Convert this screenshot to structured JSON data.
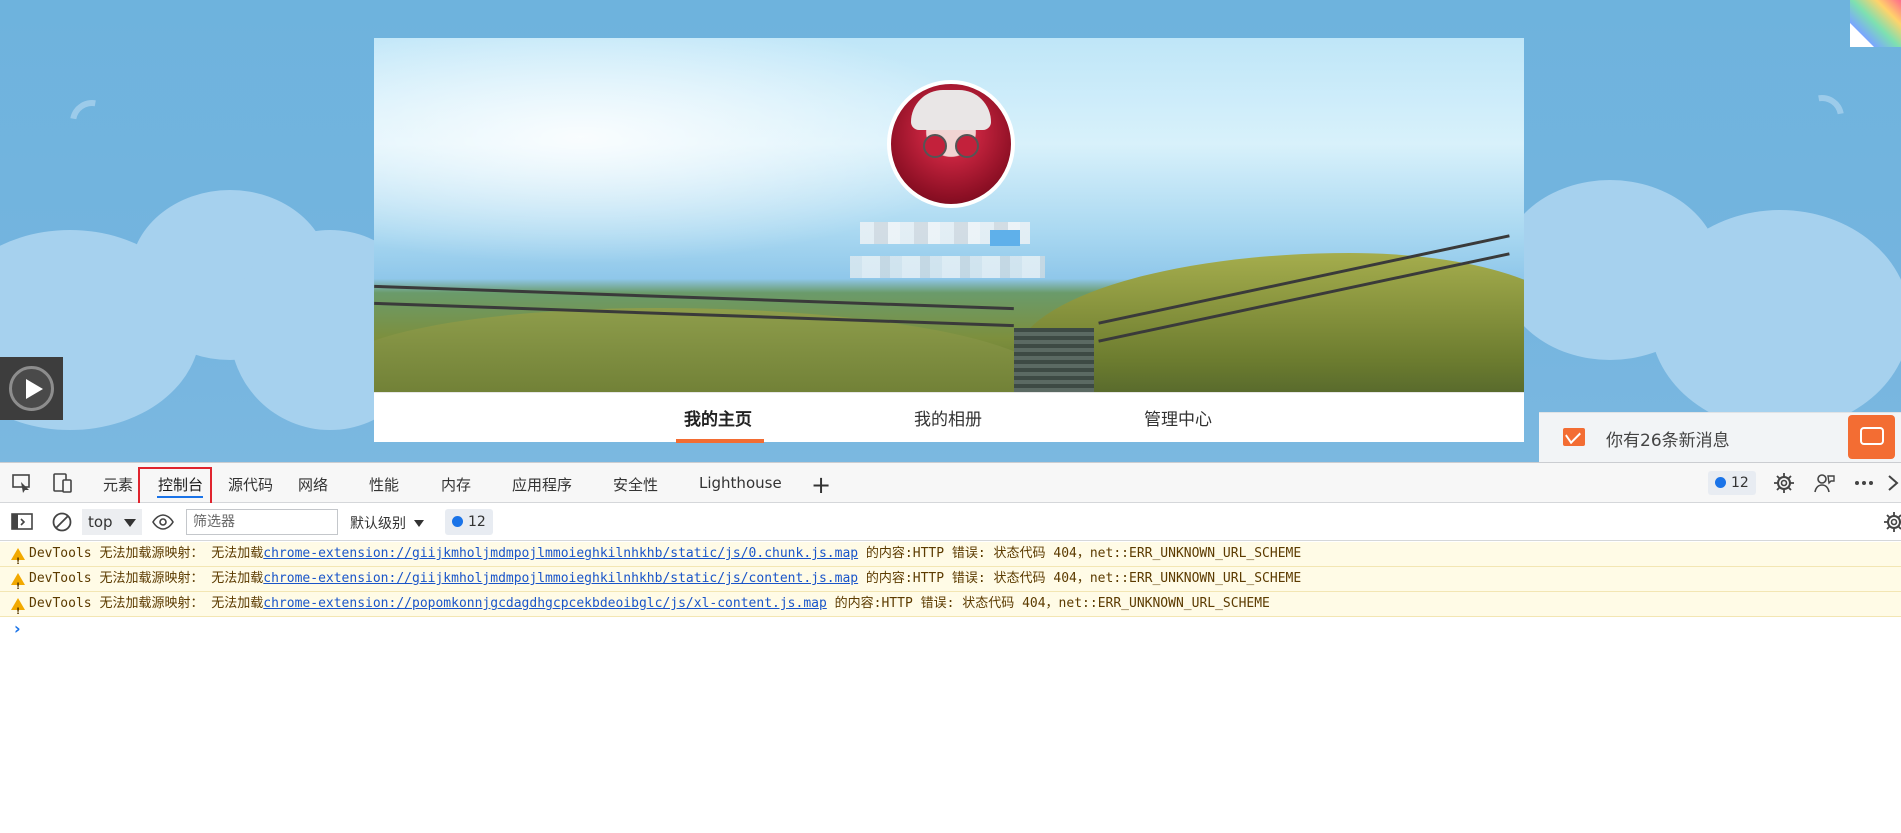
{
  "profile": {
    "nav": [
      "我的主页",
      "我的相册",
      "管理中心"
    ],
    "active_nav": "我的主页"
  },
  "messages": {
    "text": "你有26条新消息"
  },
  "devtools": {
    "tabs": [
      "元素",
      "控制台",
      "源代码",
      "网络",
      "性能",
      "内存",
      "应用程序",
      "安全性",
      "Lighthouse"
    ],
    "active_tab": "控制台",
    "issues_count": "12",
    "toolbar": {
      "context": "top",
      "filter_placeholder": "筛选器",
      "levels": "默认级别",
      "issues_count": "12"
    },
    "console": [
      {
        "level": "warning",
        "prefix": "DevTools 无法加载源映射： 无法加载",
        "link": "chrome-extension://giijkmholjmdmpojlmmoieghkilnhkhb/static/js/0.chunk.js.map",
        "suffix": " 的内容:HTTP 错误: 状态代码 404，net::ERR_UNKNOWN_URL_SCHEME"
      },
      {
        "level": "warning",
        "prefix": "DevTools 无法加载源映射： 无法加载",
        "link": "chrome-extension://giijkmholjmdmpojlmmoieghkilnhkhb/static/js/content.js.map",
        "suffix": " 的内容:HTTP 错误: 状态代码 404，net::ERR_UNKNOWN_URL_SCHEME"
      },
      {
        "level": "warning",
        "prefix": "DevTools 无法加载源映射： 无法加载",
        "link": "chrome-extension://popomkonnjgcdagdhgcpcekbdeoibglc/js/xl-content.js.map",
        "suffix": " 的内容:HTTP 错误: 状态代码 404，net::ERR_UNKNOWN_URL_SCHEME"
      }
    ]
  },
  "colors": {
    "accent_orange": "#f36d33",
    "devtools_blue": "#1a73e8",
    "highlight_red": "#e0242e",
    "warning_bg": "#fffbe6"
  }
}
